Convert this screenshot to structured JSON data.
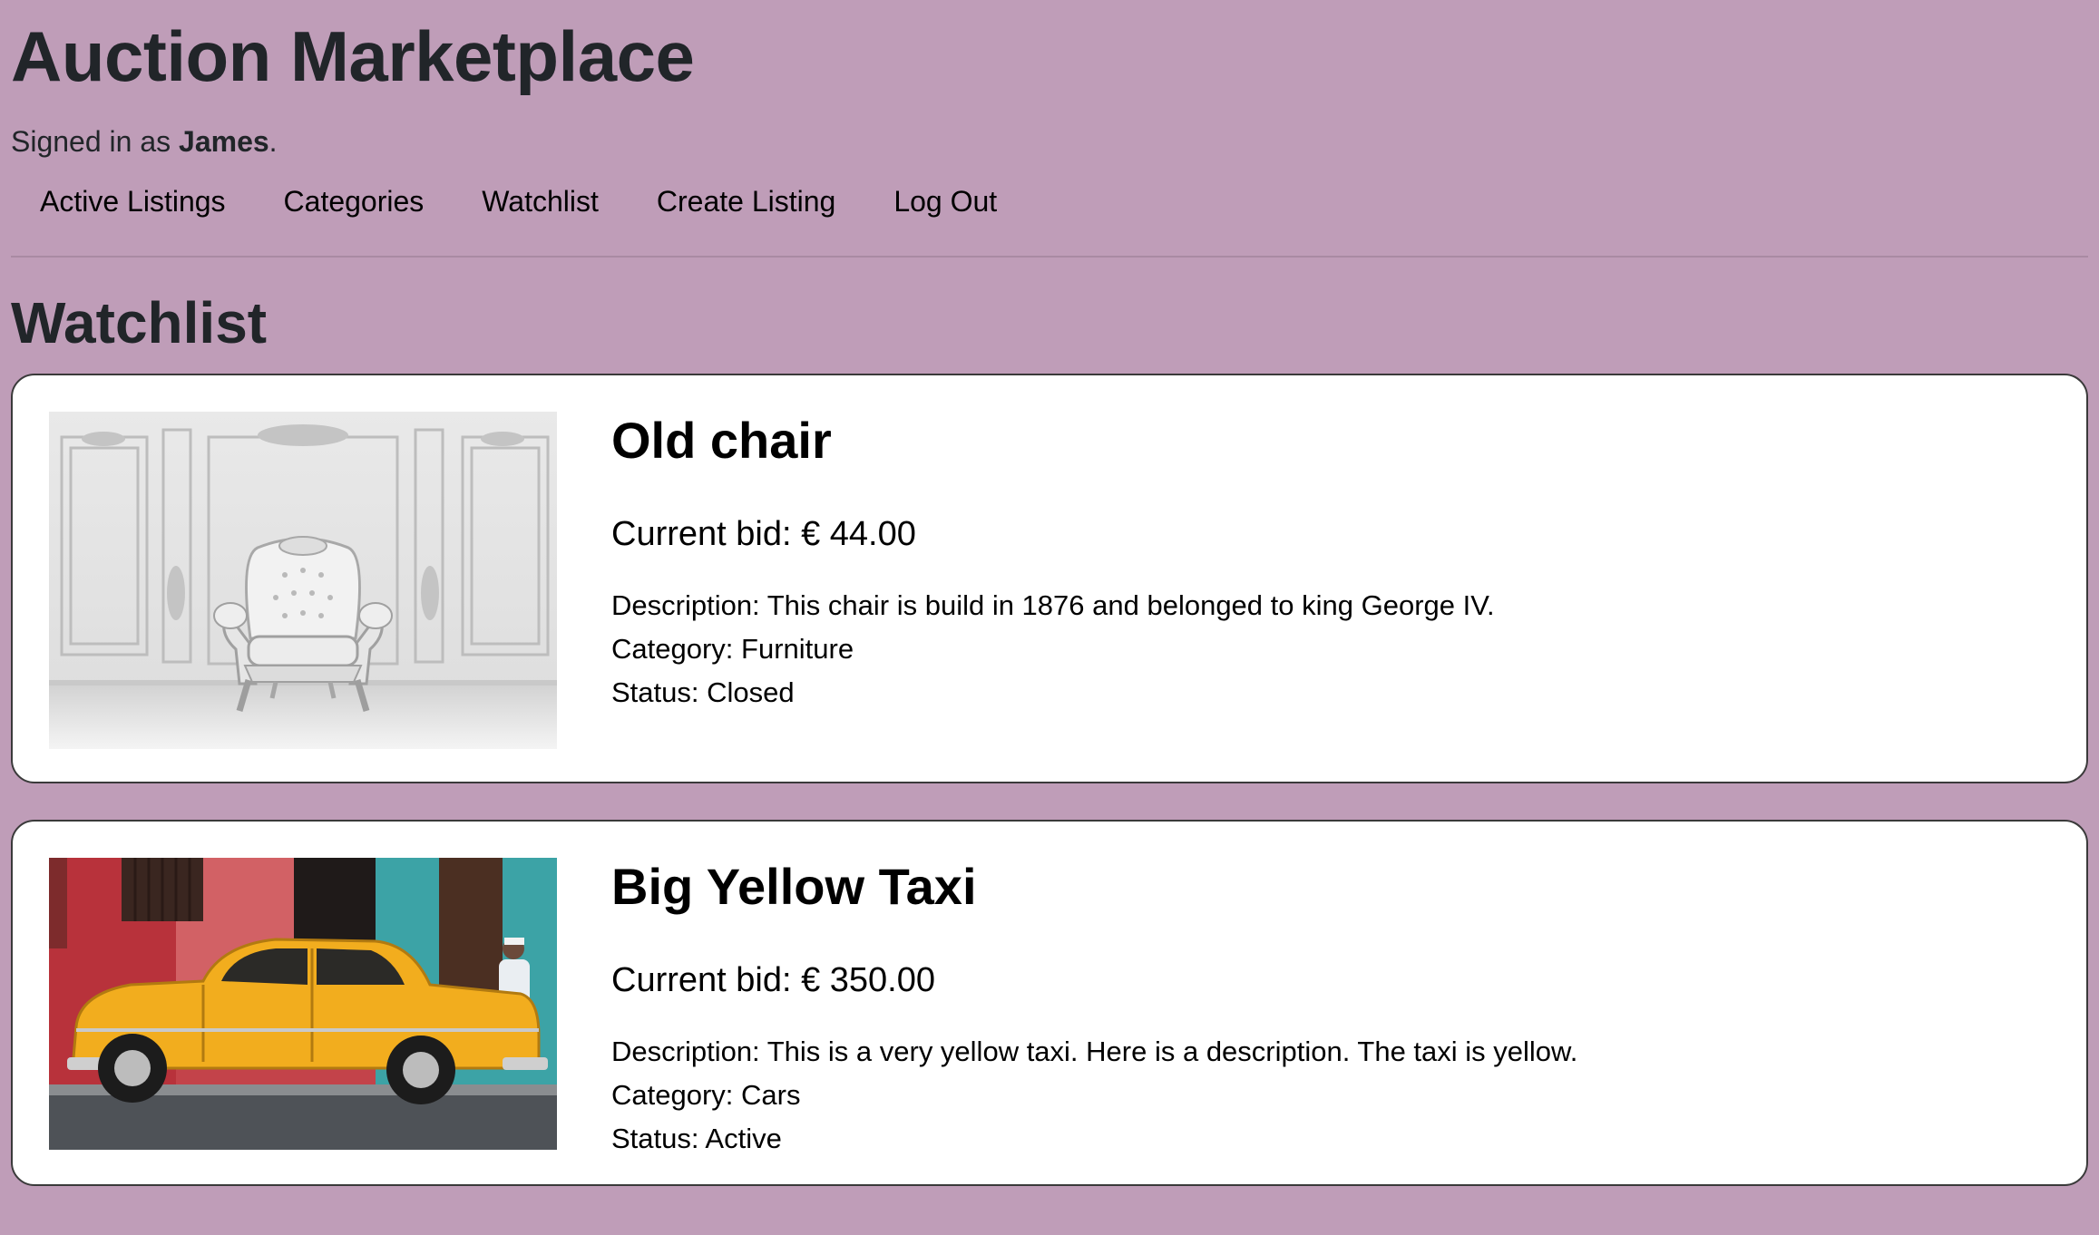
{
  "site": {
    "title": "Auction Marketplace",
    "signed_in_prefix": "Signed in as ",
    "user": "James",
    "signed_in_suffix": "."
  },
  "nav": {
    "items": [
      {
        "label": "Active Listings"
      },
      {
        "label": "Categories"
      },
      {
        "label": "Watchlist"
      },
      {
        "label": "Create Listing"
      },
      {
        "label": "Log Out"
      }
    ]
  },
  "page": {
    "heading": "Watchlist"
  },
  "listings": [
    {
      "title": "Old chair",
      "bid": "Current bid: € 44.00",
      "description": "Description: This chair is build in 1876 and belonged to king George IV.",
      "category": "Category: Furniture",
      "status": "Status: Closed",
      "image": "white-baroque-armchair-photo"
    },
    {
      "title": "Big Yellow Taxi",
      "bid": "Current bid: € 350.00",
      "description": "Description: This is a very yellow taxi. Here is a description. The taxi is yellow.",
      "category": "Category: Cars",
      "status": "Status: Active",
      "image": "yellow-vintage-taxi-photo"
    }
  ],
  "colors": {
    "background": "#bf9db8",
    "card": "#ffffff",
    "text": "#212529"
  }
}
